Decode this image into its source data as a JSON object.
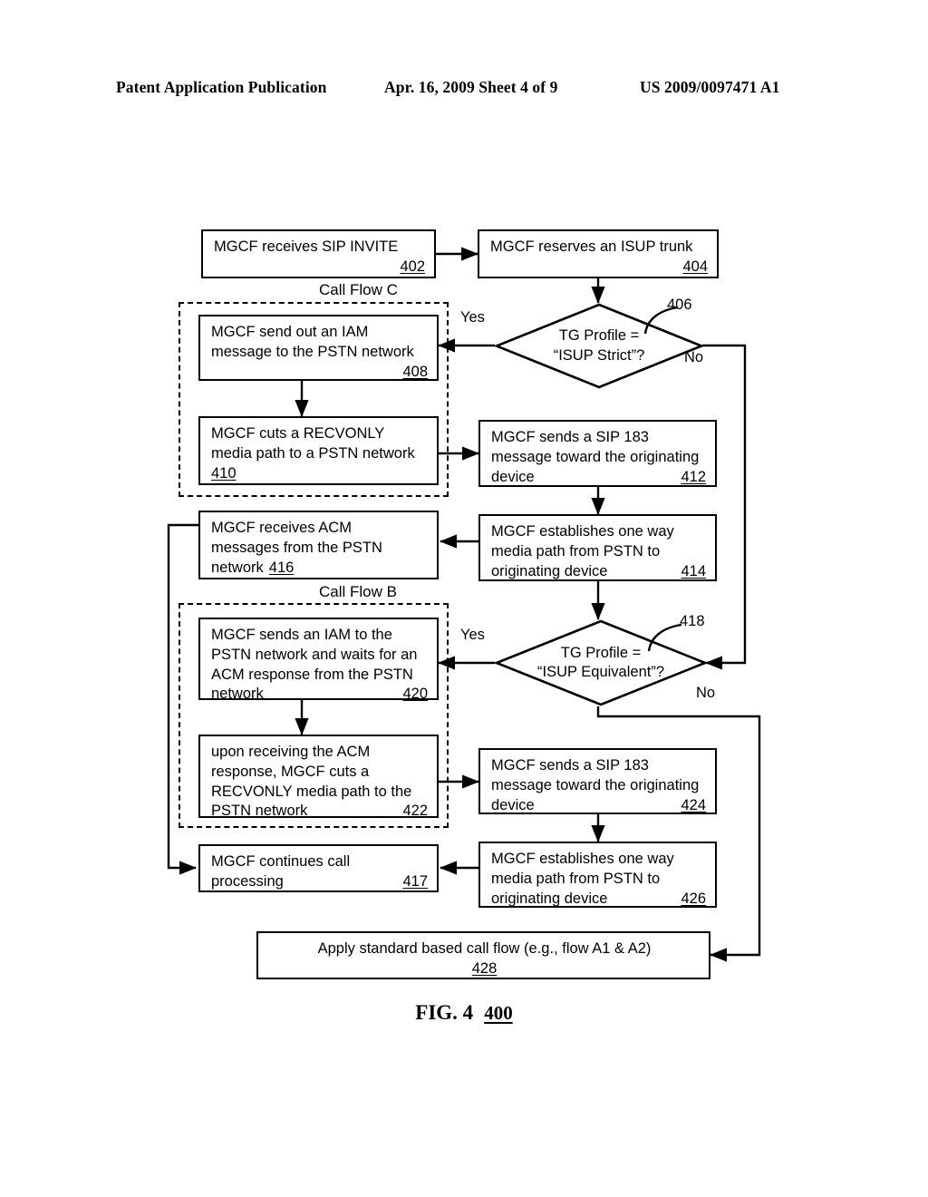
{
  "header": {
    "left": "Patent Application Publication",
    "middle": "Apr. 16, 2009  Sheet 4 of 9",
    "right": "US 2009/0097471 A1"
  },
  "figure": {
    "caption": "FIG. 4",
    "number": "400"
  },
  "groups": [
    {
      "label": "Call Flow C"
    },
    {
      "label": "Call Flow B"
    }
  ],
  "branch_labels": {
    "yes_406": "Yes",
    "no_406": "No",
    "yes_418": "Yes",
    "no_418": "No"
  },
  "nodes": {
    "n402": {
      "lines": [
        "MGCF receives SIP INVITE"
      ],
      "number": "402"
    },
    "n404": {
      "lines": [
        "MGCF reserves an ISUP trunk"
      ],
      "number": "404"
    },
    "n406": {
      "lines": [
        "TG Profile =",
        "“ISUP Strict”?"
      ],
      "number": "406"
    },
    "n408": {
      "lines": [
        "MGCF send out an IAM",
        "message to the PSTN network"
      ],
      "number": "408"
    },
    "n410": {
      "lines": [
        "MGCF cuts a RECVONLY",
        "media path to a PSTN network"
      ],
      "number": "410"
    },
    "n412": {
      "lines": [
        "MGCF sends a SIP 183",
        "message toward the originating",
        "device"
      ],
      "number": "412"
    },
    "n414": {
      "lines": [
        "MGCF establishes one way",
        "media path from PSTN to",
        "originating device"
      ],
      "number": "414"
    },
    "n416": {
      "lines": [
        "MGCF receives ACM",
        "messages from the PSTN",
        "network"
      ],
      "number": "416"
    },
    "n418": {
      "lines": [
        "TG Profile =",
        "“ISUP Equivalent”?"
      ],
      "number": "418"
    },
    "n420": {
      "lines": [
        "MGCF sends an IAM to the",
        "PSTN network and waits for an",
        "ACM response from the PSTN",
        "network"
      ],
      "number": "420"
    },
    "n422": {
      "lines": [
        "upon receiving the ACM",
        "response, MGCF cuts a",
        "RECVONLY media path to the",
        "PSTN network"
      ],
      "number": "422"
    },
    "n424": {
      "lines": [
        "MGCF sends a SIP 183",
        "message toward the originating",
        "device"
      ],
      "number": "424"
    },
    "n426": {
      "lines": [
        "MGCF establishes one way",
        "media path from PSTN to",
        "originating device"
      ],
      "number": "426"
    },
    "n417": {
      "lines": [
        "MGCF continues call",
        "processing"
      ],
      "number": "417"
    },
    "n428": {
      "lines": [
        "Apply standard based call flow  (e.g., flow A1 & A2)"
      ],
      "number": "428"
    }
  }
}
